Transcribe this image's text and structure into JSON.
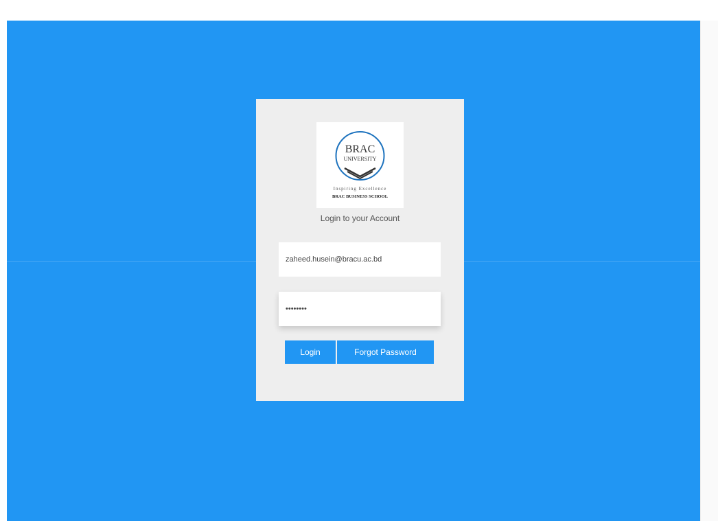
{
  "logo": {
    "line1": "BRAC",
    "line2": "UNIVERSITY",
    "tagline": "Inspiring Excellence",
    "school": "BRAC BUSINESS SCHOOL"
  },
  "card": {
    "subtitle": "Login to your Account"
  },
  "email": {
    "value": "zaheed.husein@bracu.ac.bd"
  },
  "password": {
    "value": "••••••••"
  },
  "actions": {
    "login_label": "Login",
    "forgot_label": "Forgot Password"
  },
  "colors": {
    "brand_blue": "#2196f3",
    "card_bg": "#eeeeee"
  }
}
